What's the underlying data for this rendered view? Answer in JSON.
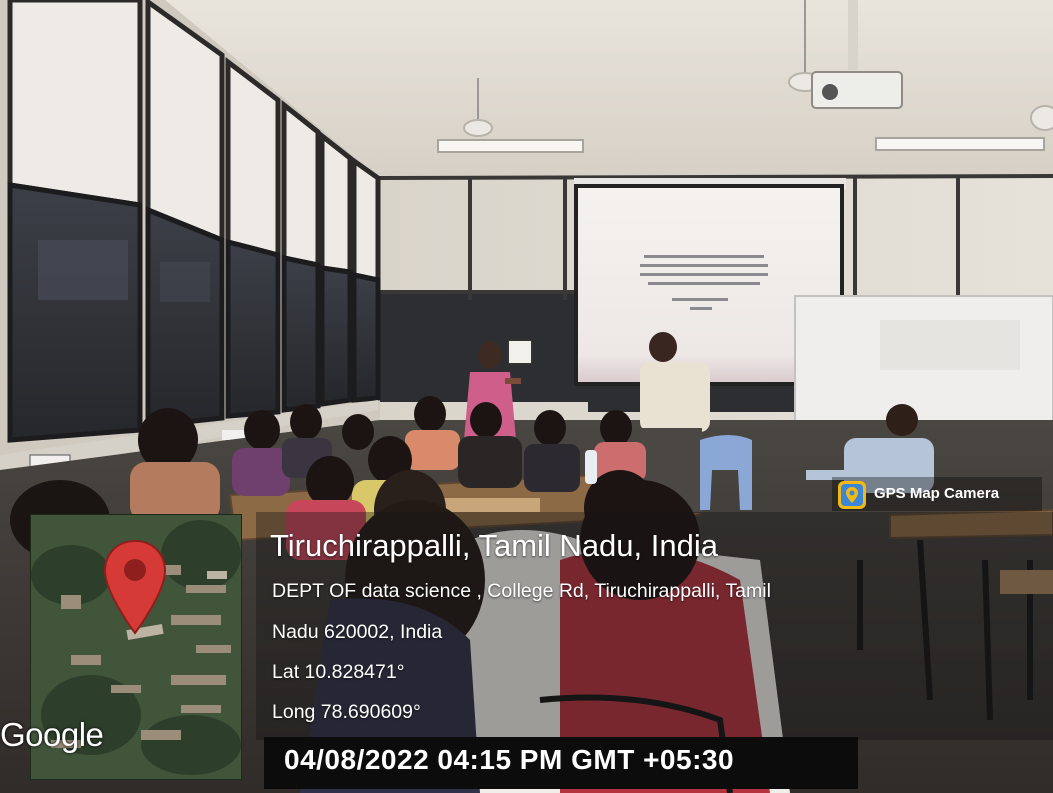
{
  "watermark": {
    "badge_label": "GPS Map Camera",
    "title": "Tiruchirappalli, Tamil Nadu, India",
    "address_line1": "DEPT OF data science , College Rd, Tiruchirappalli, Tamil",
    "address_line2": "Nadu 620002, India",
    "latitude": "Lat 10.828471°",
    "longitude": "Long 78.690609°",
    "timestamp": "04/08/2022 04:15 PM GMT +05:30",
    "map_logo_text": "Google"
  },
  "colors": {
    "map_pin": "#d63a36",
    "badge_icon_bg": "#f2b814",
    "panel_bg": "#141414",
    "timestamp_bg": "#0c0c0c"
  },
  "icons": [
    "map-pin-icon",
    "gps-map-camera-icon"
  ]
}
